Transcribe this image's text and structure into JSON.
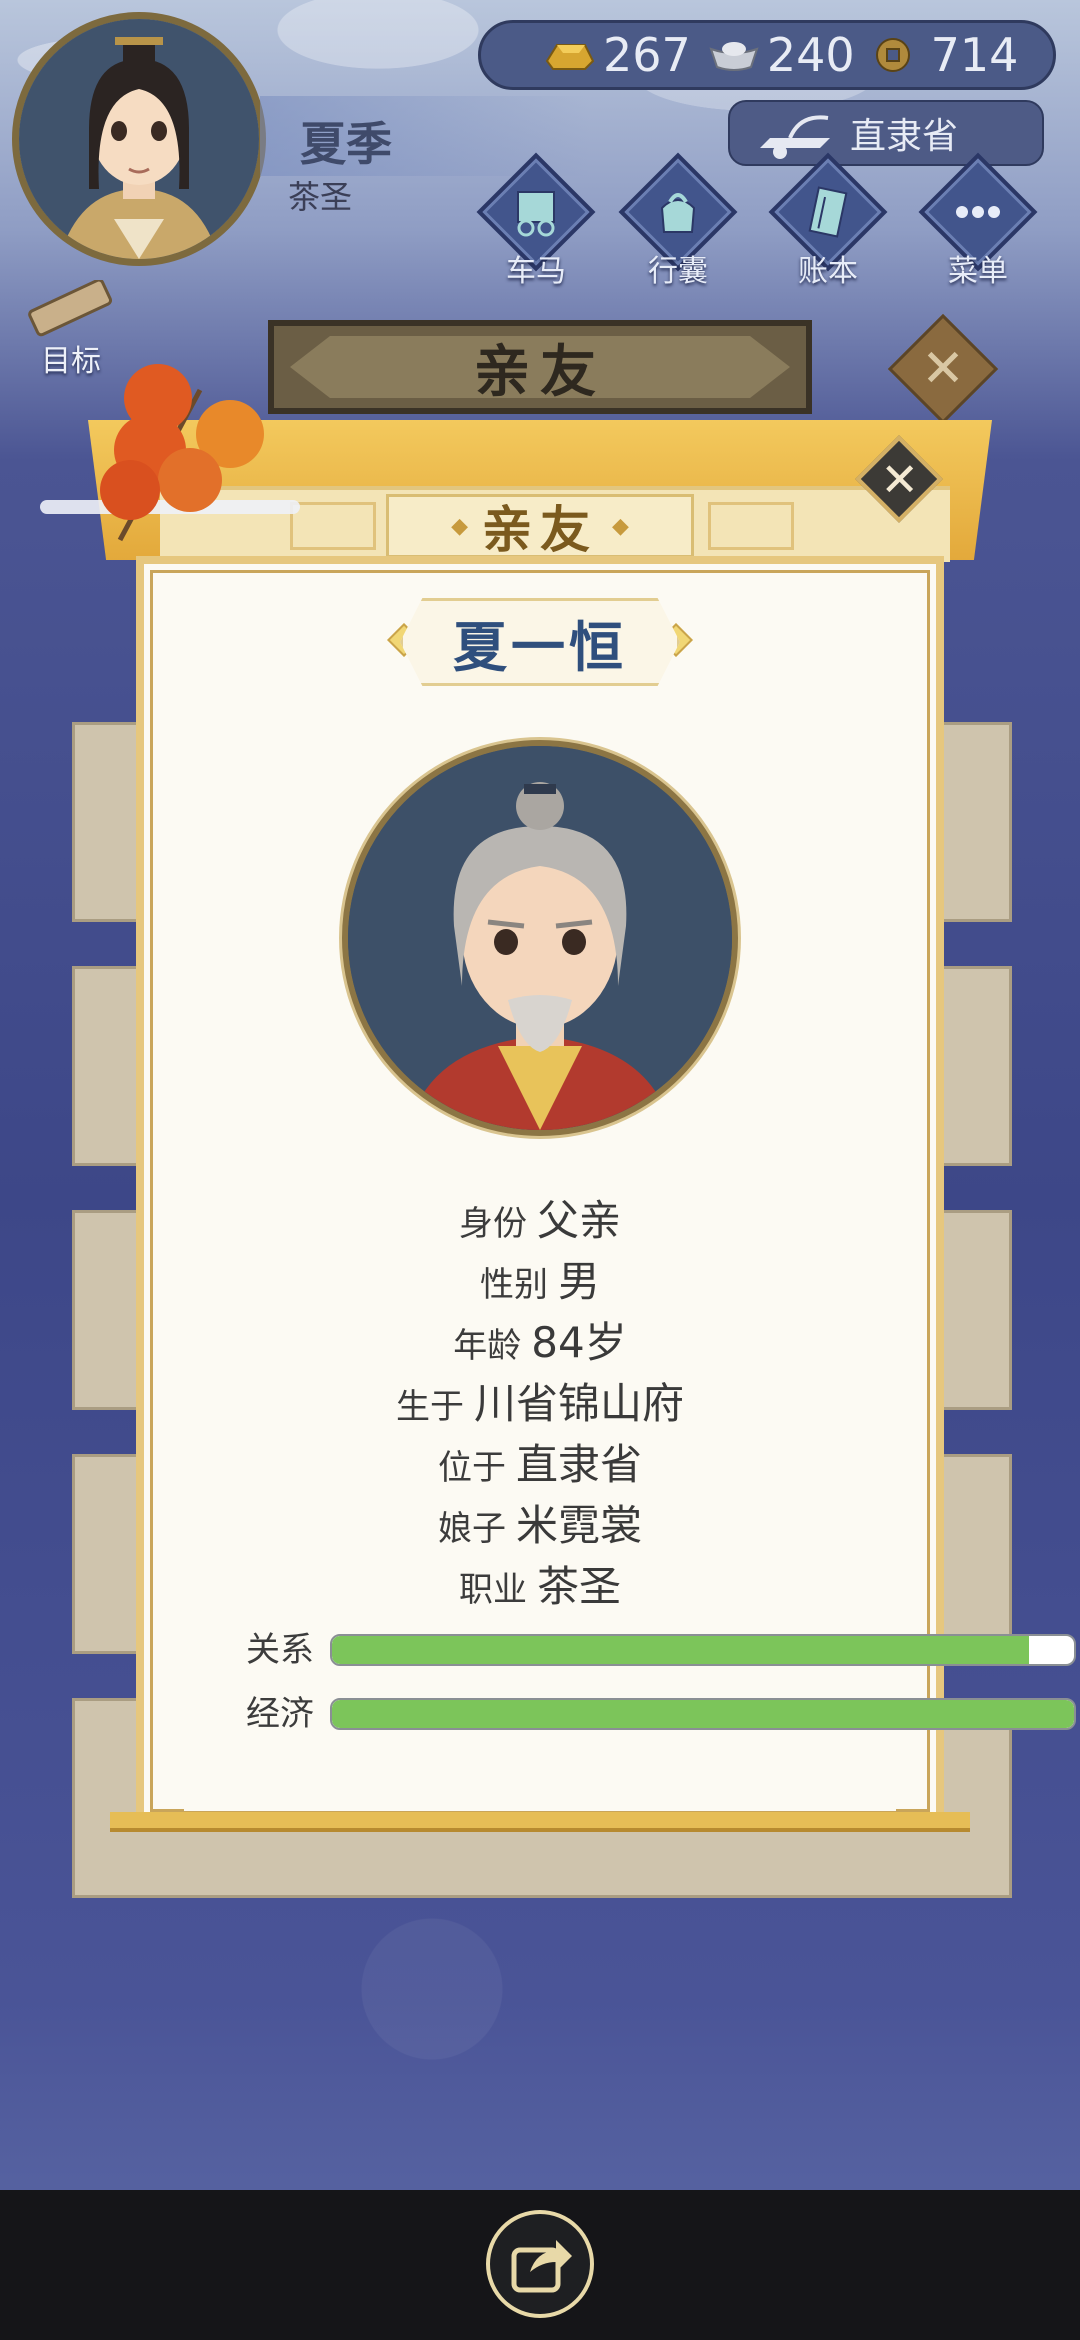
{
  "hud": {
    "player_name": "夏季",
    "player_title": "茶圣",
    "currency": [
      {
        "icon": "gold-ingot-icon",
        "value": "267"
      },
      {
        "icon": "silver-ingot-icon",
        "value": "240"
      },
      {
        "icon": "copper-coin-icon",
        "value": "714"
      }
    ],
    "location": "直隶省",
    "buttons": [
      {
        "id": "carriage",
        "label": "车马",
        "icon": "carriage-icon"
      },
      {
        "id": "bag",
        "label": "行囊",
        "icon": "bag-icon"
      },
      {
        "id": "ledger",
        "label": "账本",
        "icon": "ledger-icon"
      },
      {
        "id": "menu",
        "label": "菜单",
        "icon": "menu-dots-icon"
      }
    ],
    "goal_label": "目标"
  },
  "panel": {
    "tab_title": "亲友",
    "close_glyph": "✕"
  },
  "modal": {
    "title": "亲友",
    "title_deco": "◆",
    "close_glyph": "✕",
    "character": {
      "name": "夏一恒",
      "rows": [
        {
          "label": "身份",
          "value": "父亲"
        },
        {
          "label": "性别",
          "value": "男"
        },
        {
          "label": "年龄",
          "value": "84岁"
        },
        {
          "label": "生于",
          "value": "川省锦山府"
        },
        {
          "label": "位于",
          "value": "直隶省"
        },
        {
          "label": "娘子",
          "value": "米霓裳"
        },
        {
          "label": "职业",
          "value": "茶圣"
        }
      ],
      "bars": [
        {
          "label": "关系",
          "fraction": 0.94
        },
        {
          "label": "经济",
          "fraction": 1.0
        }
      ]
    }
  },
  "colors": {
    "bar_fill": "#7cc55a",
    "accent_gold": "#e6c77e",
    "name_blue": "#2f4f7d"
  },
  "bottom": {
    "share_icon": "share-icon"
  }
}
